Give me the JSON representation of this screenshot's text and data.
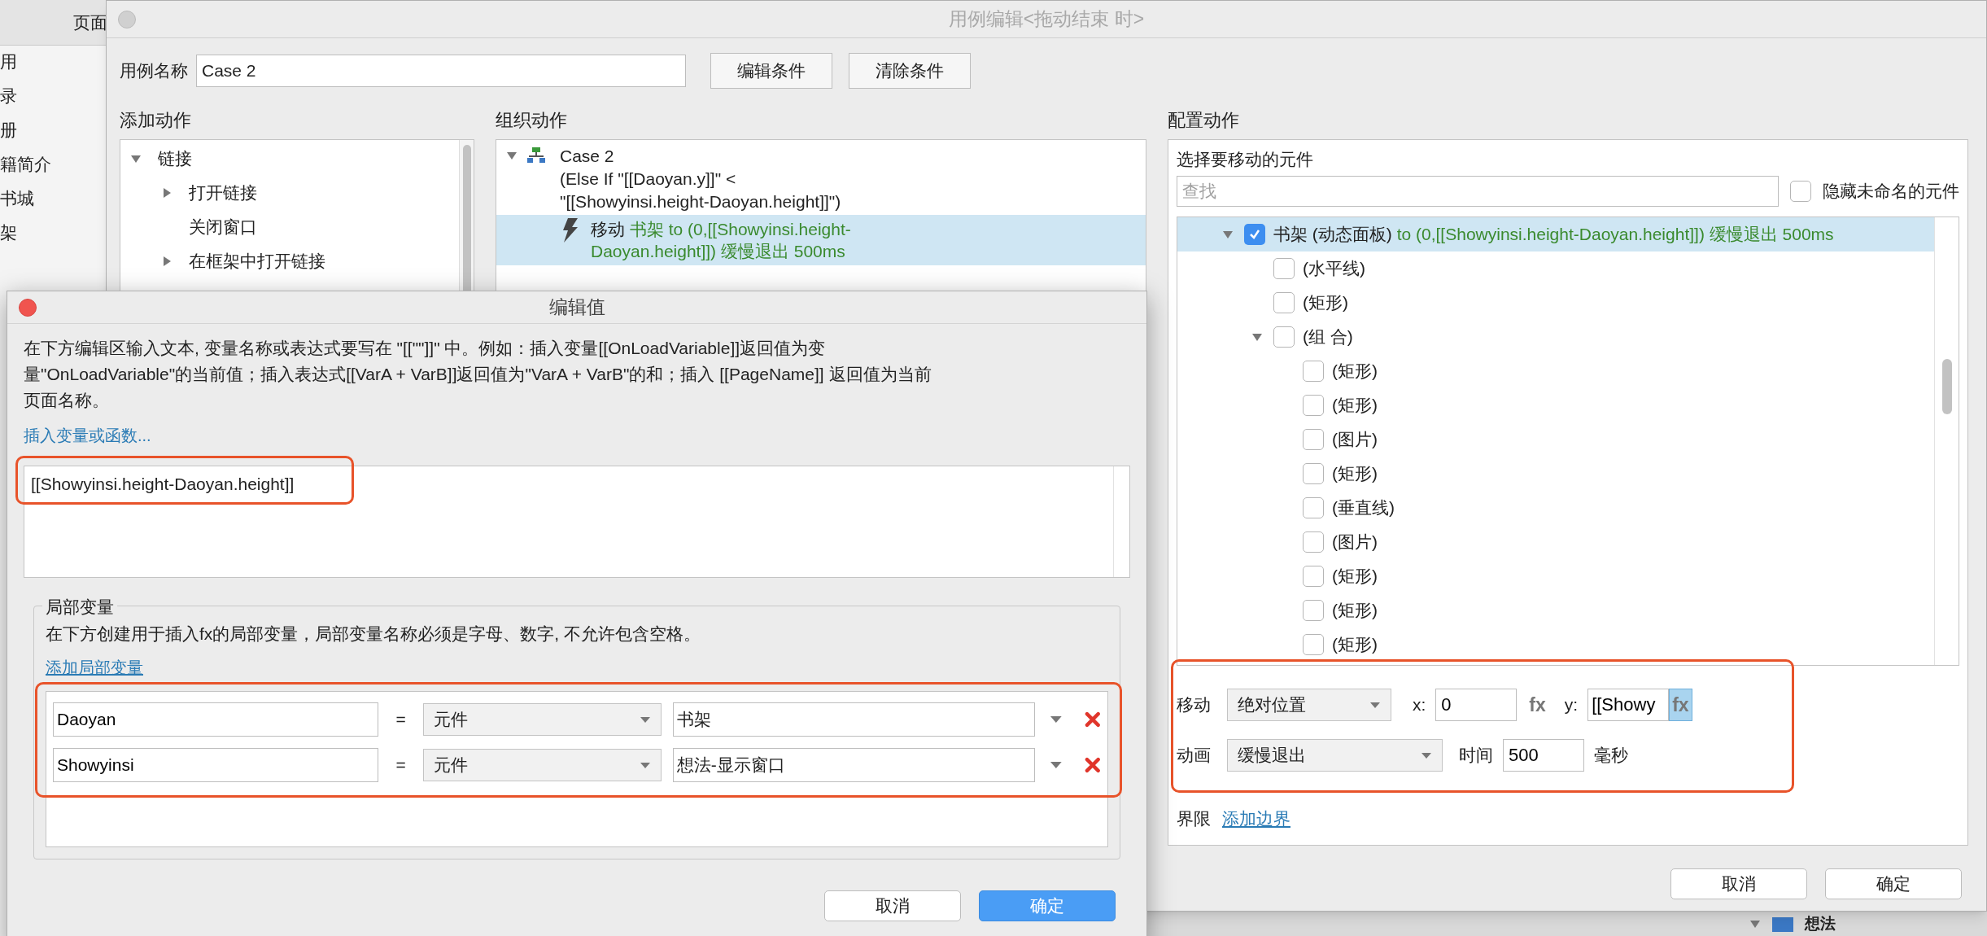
{
  "background_app": {
    "panel_header": "页面",
    "sidebar_items": [
      "用",
      "录",
      "册",
      "籍简介",
      "书城",
      "架"
    ],
    "tree_item": "想法"
  },
  "case_editor": {
    "title": "用例编辑<拖动结束 时>",
    "case_name_label": "用例名称",
    "case_name_value": "Case 2",
    "buttons": [
      "编辑条件",
      "清除条件"
    ],
    "add_actions": {
      "heading": "添加动作",
      "items": [
        {
          "label": "链接",
          "expanded": true,
          "children": [
            {
              "label": "打开链接",
              "expanded": false
            },
            {
              "label": "关闭窗口"
            },
            {
              "label": "在框架中打开链接",
              "expanded": false
            }
          ]
        }
      ]
    },
    "organize_actions": {
      "heading": "组织动作",
      "case": {
        "title": "Case 2",
        "expanded": true,
        "condition_lines": [
          "(Else If \"[[Daoyan.y]]\" <",
          "\"[[Showyinsi.height-Daoyan.height]]\")"
        ],
        "actions": [
          {
            "verb": "移动",
            "detail_lines": [
              "书架 to (0,[[Showyinsi.height-",
              "Daoyan.height]]) 缓慢退出 500ms"
            ],
            "selected": true
          }
        ]
      }
    },
    "configure_action": {
      "heading": "配置动作",
      "subheading": "选择要移动的元件",
      "search": {
        "placeholder": "查找"
      },
      "hide_unnamed": {
        "label": "隐藏未命名的元件",
        "checked": false
      },
      "tree": [
        {
          "name": "书架 (动态面板)",
          "detail": "to (0,[[Showyinsi.height-Daoyan.height]]) 缓慢退出 500ms",
          "checked": true,
          "selected": true,
          "expanded": true,
          "children": [
            {
              "name": "(水平线)",
              "checked": false,
              "selected": false
            },
            {
              "name": "(矩形)",
              "checked": false,
              "selected": false
            },
            {
              "name": "(组 合)",
              "checked": false,
              "selected": false,
              "expanded": true,
              "children": [
                {
                  "name": "(矩形)",
                  "checked": false,
                  "selected": false
                },
                {
                  "name": "(矩形)",
                  "checked": false,
                  "selected": false
                },
                {
                  "name": "(图片)",
                  "checked": false,
                  "selected": false
                },
                {
                  "name": "(矩形)",
                  "checked": false,
                  "selected": false
                },
                {
                  "name": "(垂直线)",
                  "checked": false,
                  "selected": false
                },
                {
                  "name": "(图片)",
                  "checked": false,
                  "selected": false
                },
                {
                  "name": "(矩形)",
                  "checked": false,
                  "selected": false
                },
                {
                  "name": "(矩形)",
                  "checked": false,
                  "selected": false
                },
                {
                  "name": "(矩形)",
                  "checked": false,
                  "selected": false
                }
              ]
            }
          ]
        }
      ],
      "move": {
        "label": "移动",
        "mode": "绝对位置",
        "x_label": "x:",
        "x_value": "0",
        "x_fx": {
          "label": "fx",
          "selected": false
        },
        "y_label": "y:",
        "y_value": "[[Showy",
        "y_fx": {
          "label": "fx",
          "selected": true
        }
      },
      "animation": {
        "label": "动画",
        "easing": "缓慢退出",
        "time_label": "时间",
        "time_value": "500",
        "unit": "毫秒"
      },
      "bounds": {
        "label": "界限",
        "link": "添加边界"
      }
    },
    "footer_buttons": [
      {
        "label": "取消",
        "kind": "default"
      },
      {
        "label": "确定",
        "kind": "default"
      }
    ]
  },
  "edit_value_dialog": {
    "title": "编辑值",
    "description": "在下方编辑区输入文本, 变量名称或表达式要写在 \"[[\"\"]]\" 中。例如：插入变量[[OnLoadVariable]]返回值为变量\"OnLoadVariable\"的当前值；插入表达式[[VarA + VarB]]返回值为\"VarA + VarB\"的和；插入 [[PageName]] 返回值为当前页面名称。",
    "insert_link": "插入变量或函数...",
    "value": "[[Showyinsi.height-Daoyan.height]]",
    "local_variables": {
      "title": "局部变量",
      "description": "在下方创建用于插入fx的局部变量，局部变量名称必须是字母、数字, 不允许包含空格。",
      "add_link": "添加局部变量",
      "rows": [
        {
          "name": "Daoyan",
          "operator": "=",
          "type": "元件",
          "target": "书架"
        },
        {
          "name": "Showyinsi",
          "operator": "=",
          "type": "元件",
          "target": "想法-显示窗口"
        }
      ]
    },
    "buttons": [
      {
        "label": "取消",
        "kind": "default"
      },
      {
        "label": "确定",
        "kind": "primary"
      }
    ]
  }
}
